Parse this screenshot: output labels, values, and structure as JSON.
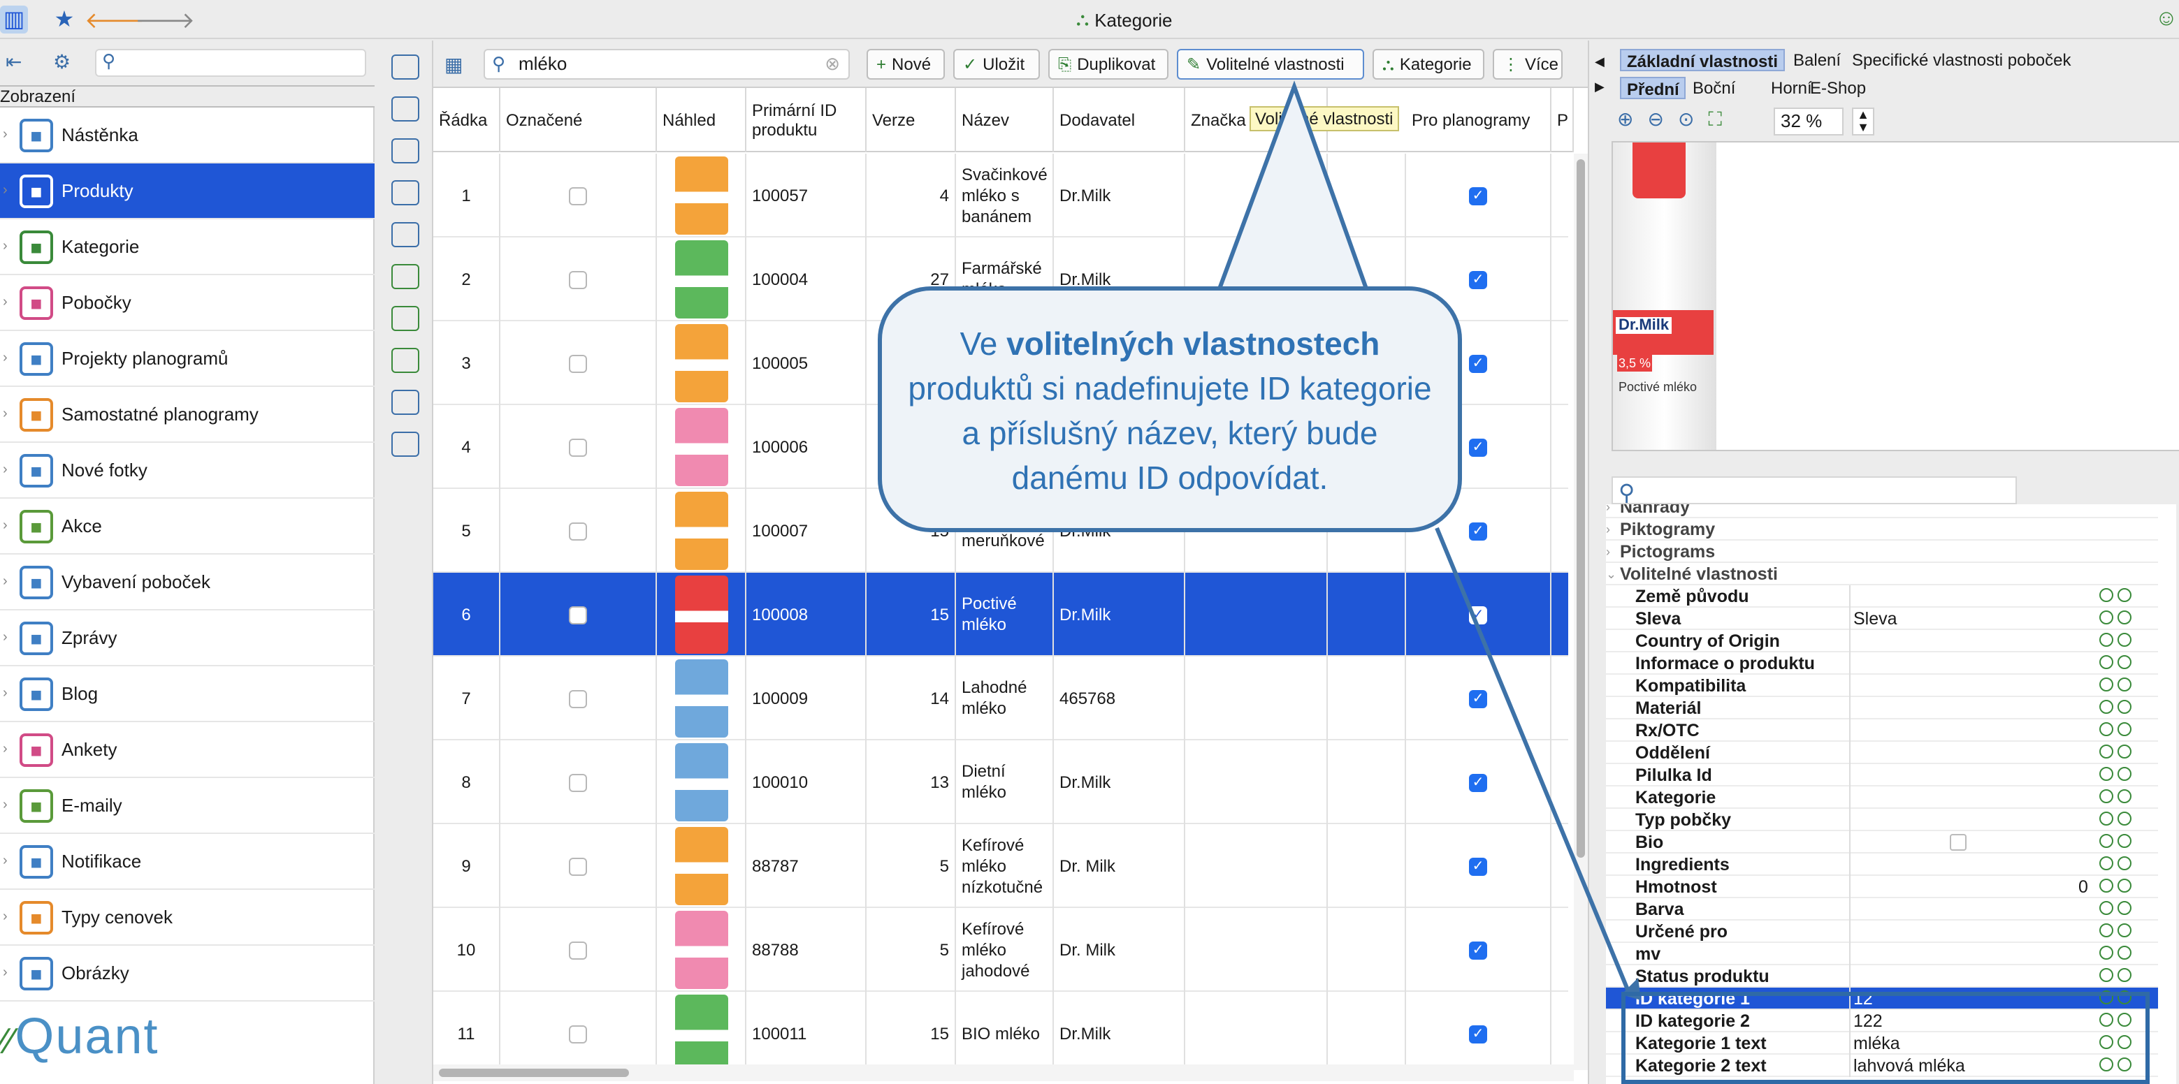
{
  "window": {
    "title": "Kategorie"
  },
  "sidebar": {
    "section_label": "Zobrazení",
    "items": [
      {
        "label": "Nástěnka",
        "icon": "dashboard-icon",
        "color": "#3f7fc4"
      },
      {
        "label": "Produkty",
        "icon": "product-icon",
        "color": "#3f7fc4",
        "active": true
      },
      {
        "label": "Kategorie",
        "icon": "category-tree-icon",
        "color": "#3a8a3a"
      },
      {
        "label": "Pobočky",
        "icon": "store-icon",
        "color": "#d14b86"
      },
      {
        "label": "Projekty planogramů",
        "icon": "planogram-project-icon",
        "color": "#3f7fc4"
      },
      {
        "label": "Samostatné planogramy",
        "icon": "planogram-icon",
        "color": "#e58a2b"
      },
      {
        "label": "Nové fotky",
        "icon": "camera-icon",
        "color": "#3f7fc4"
      },
      {
        "label": "Akce",
        "icon": "promo-icon",
        "color": "#5a9a3a"
      },
      {
        "label": "Vybavení poboček",
        "icon": "equipment-icon",
        "color": "#3f7fc4"
      },
      {
        "label": "Zprávy",
        "icon": "message-icon",
        "color": "#3f7fc4"
      },
      {
        "label": "Blog",
        "icon": "blog-icon",
        "color": "#3f7fc4"
      },
      {
        "label": "Ankety",
        "icon": "survey-icon",
        "color": "#d14b86"
      },
      {
        "label": "E-maily",
        "icon": "email-icon",
        "color": "#5a9a3a"
      },
      {
        "label": "Notifikace",
        "icon": "notification-icon",
        "color": "#3f7fc4"
      },
      {
        "label": "Typy cenovek",
        "icon": "price-tag-icon",
        "color": "#e58a2b"
      },
      {
        "label": "Obrázky",
        "icon": "image-icon",
        "color": "#3f7fc4"
      }
    ],
    "logo": "Quant"
  },
  "toolbar": {
    "search_value": "mléko",
    "buttons": [
      "Nové",
      "Uložit",
      "Duplikovat",
      "Volitelné vlastnosti",
      "Kategorie",
      "Více"
    ]
  },
  "table": {
    "columns": [
      "Řádka",
      "Označené",
      "Náhled",
      "Primární ID produktu",
      "Verze",
      "Název",
      "Dodavatel",
      "Značka",
      "Volitelné vlastnosti",
      "Pro planogramy",
      "P"
    ],
    "rows": [
      {
        "n": "1",
        "id": "100057",
        "ver": "4",
        "name": "Svačinkové mléko s banánem",
        "sup": "Dr.Milk",
        "thumb": "#f4a33a"
      },
      {
        "n": "2",
        "id": "100004",
        "ver": "27",
        "name": "Farmářské mléko...",
        "sup": "Dr.Milk",
        "thumb": "#5cb85c"
      },
      {
        "n": "3",
        "id": "100005",
        "ver": "",
        "name": "",
        "sup": "",
        "thumb": "#f4a33a"
      },
      {
        "n": "4",
        "id": "100006",
        "ver": "",
        "name": "",
        "sup": "",
        "thumb": "#f08ab0"
      },
      {
        "n": "5",
        "id": "100007",
        "ver": "15",
        "name": "mléko meruňkové",
        "sup": "Dr.Milk",
        "thumb": "#f4a33a"
      },
      {
        "n": "6",
        "id": "100008",
        "ver": "15",
        "name": "Poctivé mléko",
        "sup": "Dr.Milk",
        "thumb": "#e84040",
        "sel": true
      },
      {
        "n": "7",
        "id": "100009",
        "ver": "14",
        "name": "Lahodné mléko",
        "sup": "465768",
        "thumb": "#6fa8dc"
      },
      {
        "n": "8",
        "id": "100010",
        "ver": "13",
        "name": "Dietní mléko",
        "sup": "Dr.Milk",
        "thumb": "#6fa8dc"
      },
      {
        "n": "9",
        "id": "88787",
        "ver": "5",
        "name": "Kefírové mléko nízkotučné",
        "sup": "Dr. Milk",
        "thumb": "#f4a33a"
      },
      {
        "n": "10",
        "id": "88788",
        "ver": "5",
        "name": "Kefírové mléko jahodové",
        "sup": "Dr. Milk",
        "thumb": "#f08ab0"
      },
      {
        "n": "11",
        "id": "100011",
        "ver": "15",
        "name": "BIO mléko",
        "sup": "Dr.Milk",
        "thumb": "#5cb85c"
      }
    ]
  },
  "right_panel": {
    "tabs_top": [
      "Základní vlastnosti",
      "Balení",
      "Specifické vlastnosti poboček"
    ],
    "tabs_view": [
      "Přední",
      "Boční",
      "Horní",
      "E-Shop"
    ],
    "zoom": "32 %",
    "preview": {
      "brand": "Dr.Milk",
      "fat": "3,5 %",
      "product": "Poctivé mléko"
    },
    "groups": [
      "Náhrady",
      "Piktogramy",
      "Pictograms",
      "Volitelné vlastnosti"
    ],
    "properties": [
      {
        "k": "Země původu",
        "v": ""
      },
      {
        "k": "Sleva",
        "v": "Sleva"
      },
      {
        "k": "Country of Origin",
        "v": ""
      },
      {
        "k": "Informace o produktu",
        "v": ""
      },
      {
        "k": "Kompatibilita",
        "v": ""
      },
      {
        "k": "Materiál",
        "v": ""
      },
      {
        "k": "Rx/OTC",
        "v": ""
      },
      {
        "k": "Oddělení",
        "v": ""
      },
      {
        "k": "Pilulka Id",
        "v": ""
      },
      {
        "k": "Kategorie",
        "v": ""
      },
      {
        "k": "Typ pobčky",
        "v": ""
      },
      {
        "k": "Bio",
        "v": ""
      },
      {
        "k": "Ingredients",
        "v": ""
      },
      {
        "k": "Hmotnost",
        "v": "0"
      },
      {
        "k": "Barva",
        "v": ""
      },
      {
        "k": "Určené pro",
        "v": ""
      },
      {
        "k": "mv",
        "v": ""
      },
      {
        "k": "Status produktu",
        "v": ""
      },
      {
        "k": "ID kategorie 1",
        "v": "12",
        "sel": true
      },
      {
        "k": "ID kategorie 2",
        "v": "122"
      },
      {
        "k": "Kategorie 1 text",
        "v": "mléka"
      },
      {
        "k": "Kategorie 2 text",
        "v": "lahvová mléka"
      }
    ]
  },
  "callout": {
    "pre": "Ve ",
    "bold": "volitelných vlastnostech",
    "rest": "produktů si nadefinujete ID kategorie a příslušný název, který bude danému ID odpovídat."
  },
  "tooltip": "Volitelné vlastnosti"
}
